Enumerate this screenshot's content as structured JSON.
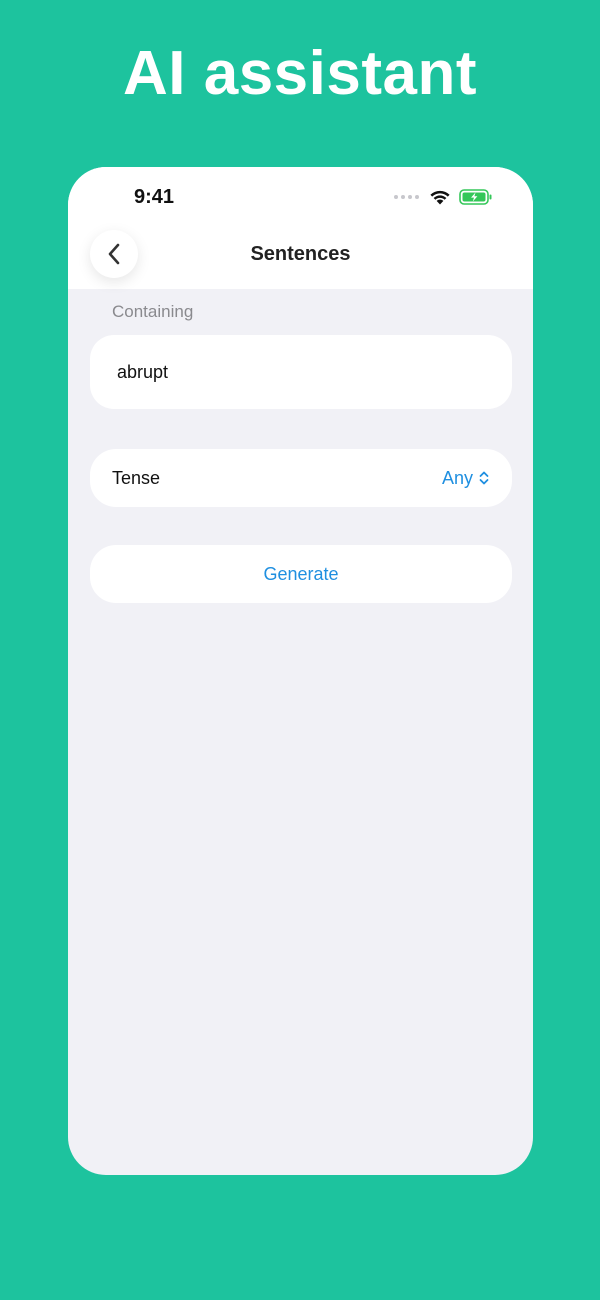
{
  "promo": {
    "title": "AI assistant"
  },
  "status_bar": {
    "time": "9:41",
    "icons": [
      "signal-dots-icon",
      "wifi-icon",
      "battery-charging-icon"
    ],
    "battery_color": "#34C759"
  },
  "nav": {
    "back_icon": "chevron-left-icon",
    "title": "Sentences"
  },
  "form": {
    "containing_label": "Containing",
    "containing_value": "abrupt",
    "tense_label": "Tense",
    "tense_value": "Any",
    "tense_icon": "chevron-up-down-icon",
    "generate_label": "Generate"
  },
  "colors": {
    "background": "#1DC39E",
    "accent": "#1F8FE0",
    "screen": "#F1F1F6"
  }
}
